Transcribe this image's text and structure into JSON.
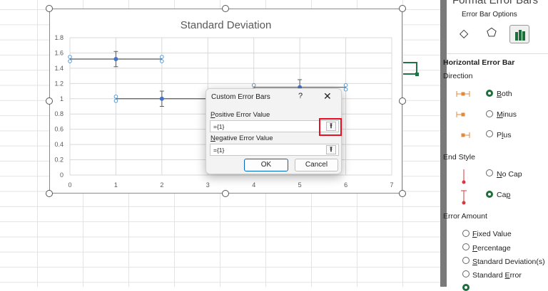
{
  "chart": {
    "chart_data": {
      "type": "scatter",
      "title": "Standard Deviation",
      "xlim": [
        0,
        7
      ],
      "ylim": [
        0,
        1.8
      ],
      "x_ticks": [
        "0",
        "1",
        "2",
        "3",
        "4",
        "5",
        "6",
        "7"
      ],
      "y_ticks": [
        "0",
        "0.2",
        "0.4",
        "0.6",
        "0.8",
        "1",
        "1.2",
        "1.4",
        "1.6",
        "1.8"
      ],
      "grid": true,
      "points": [
        {
          "x": 1,
          "y": 1.52
        },
        {
          "x": 2,
          "y": 1.0
        },
        {
          "x": 5,
          "y": 1.15
        }
      ],
      "x_error": 1,
      "y_error": 0.1,
      "marker_color": "#4472c4",
      "error_bar_color": "#595959",
      "selection_color": "#5b9bd5"
    }
  },
  "dialog": {
    "title": "Custom Error Bars",
    "help": "?",
    "close": "✕",
    "positive_label_key": "P",
    "positive_label_rest": "ositive Error Value",
    "positive_value": "={1}",
    "negative_label_key": "N",
    "negative_label_rest": "egative Error Value",
    "negative_value": "={1}",
    "collapse_icon": "⭱",
    "ok": "OK",
    "cancel": "Cancel",
    "highlight_color": "#e81123"
  },
  "pane": {
    "title": "Format Error Bars",
    "section": "Error Bar Options",
    "heading": "Horizontal Error Bar",
    "direction": "Direction",
    "dir_options": [
      {
        "key": "B",
        "rest": "oth",
        "selected": true
      },
      {
        "key": "M",
        "rest": "inus",
        "selected": false
      },
      {
        "pre": "P",
        "key": "l",
        "rest": "us",
        "selected": false
      }
    ],
    "end_style": "End Style",
    "end_options": [
      {
        "key": "N",
        "rest": "o Cap",
        "selected": false
      },
      {
        "pre": "Ca",
        "key": "p",
        "rest": "",
        "selected": true
      }
    ],
    "error_amount": "Error Amount",
    "amount_options": [
      {
        "key": "F",
        "rest": "ixed Value"
      },
      {
        "key": "P",
        "rest": "ercentage"
      },
      {
        "key": "S",
        "rest": "tandard Deviation(s)"
      },
      {
        "pre": "Standard ",
        "key": "E",
        "rest": "rror"
      }
    ],
    "accent": "#1e6e3c"
  }
}
